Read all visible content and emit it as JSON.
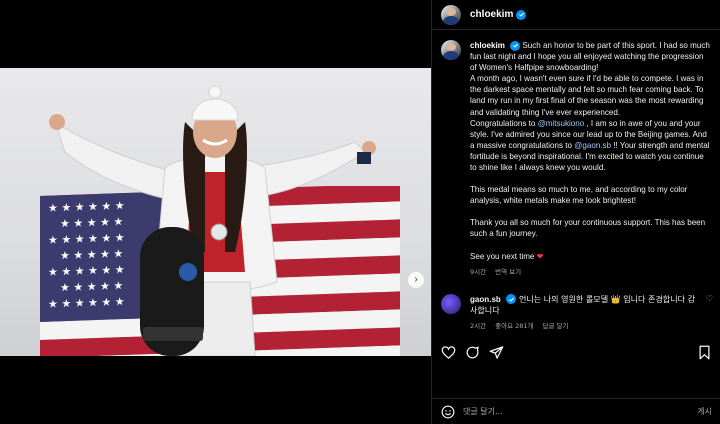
{
  "post": {
    "username": "chloekim",
    "caption": [
      "Such an honor to be part of this sport. I had so much fun last night and I hope you all enjoyed watching the progression of Women's Halfpipe snowboarding!",
      "A month ago, I wasn't even sure if I'd be able to compete. I was in the darkest space mentally and felt so much fear coming back. To land my run in my first final of the season was the most rewarding and validating thing I've ever experienced.",
      "Congratulations to",
      "@mitsukiono",
      ", I am so in awe of you and your style. I've admired you since our lead up to the Beijing games. And a massive congratulations to",
      "@gaon.sb",
      "!! Your strength and mental fortitude is beyond inspirational. I'm excited to watch you continue to shine like I always knew you would.",
      "This medal means so much to me, and according to my color analysis, white metals make me look brightest!",
      "Thank you all so much for your continuous support. This has been such a fun journey.",
      "See you next time",
      "❤"
    ],
    "time": "9시간",
    "see_translation": "번역 보기"
  },
  "comment": {
    "username": "gaon.sb",
    "text": "언니는 나의 영원한 롤모델 👑 입니다 존경합니다 감사합니다",
    "time": "2시간",
    "likes": "좋아요 281개",
    "reply": "답글 달기"
  },
  "comment_bar": {
    "placeholder": "댓글 달기...",
    "post_label": "게시"
  },
  "colors": {
    "verified": "#0095f6",
    "flag_red": "#b22234",
    "flag_blue": "#3c3b6e"
  },
  "icons": [
    "verified-icon",
    "heart-icon",
    "comment-icon",
    "share-icon",
    "bookmark-icon",
    "emoji-icon",
    "chevron-right-icon"
  ]
}
